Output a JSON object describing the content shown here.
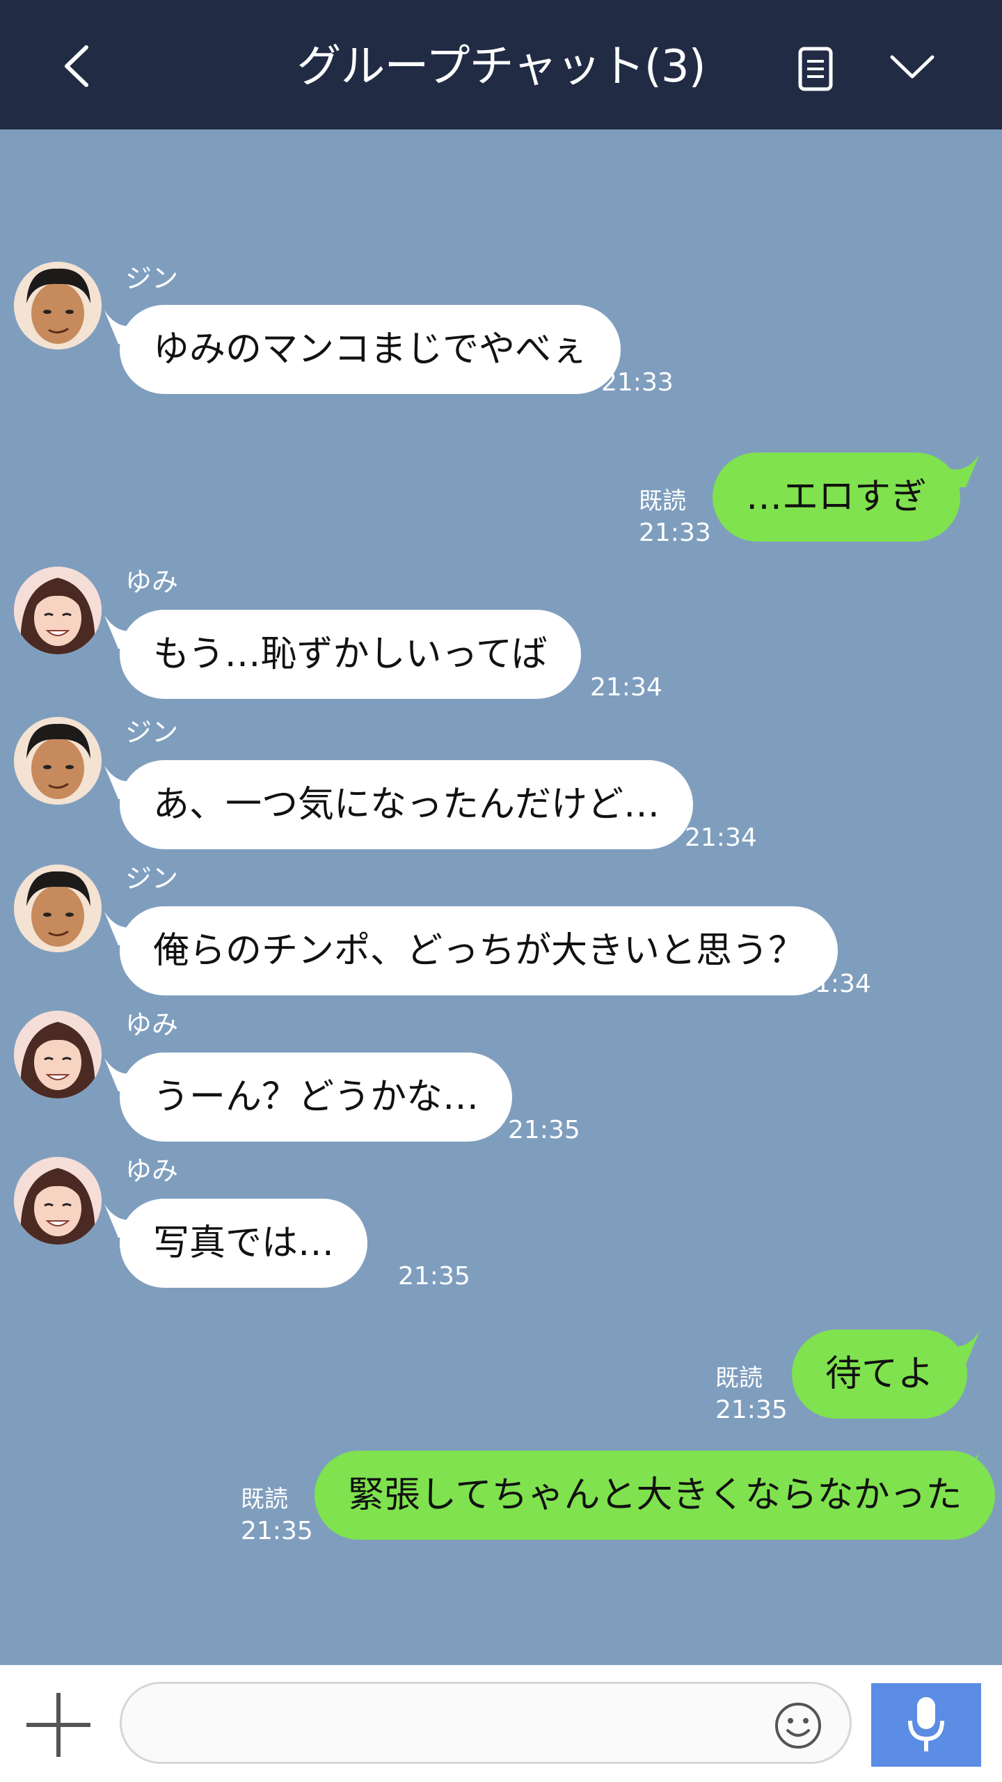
{
  "header": {
    "title": "グループチャット(3)",
    "back_icon": "chevron-left-icon",
    "notes_icon": "notes-icon",
    "menu_icon": "chevron-down-icon",
    "bg_color": "#212b44"
  },
  "chat": {
    "bg_color": "#7f9ebe",
    "incoming_color": "#ffffff",
    "outgoing_color": "#7fe24e",
    "messages": [
      {
        "dir": "in",
        "sender": "ジン",
        "text": "ゆみのマンコまじでやべぇ",
        "time": "21:33"
      },
      {
        "dir": "out",
        "read": "既読",
        "text": "…エロすぎ",
        "time": "21:33"
      },
      {
        "dir": "in",
        "sender": "ゆみ",
        "text": "もう…恥ずかしいってば",
        "time": "21:34"
      },
      {
        "dir": "in",
        "sender": "ジン",
        "text": "あ、一つ気になったんだけど…",
        "time": "21:34"
      },
      {
        "dir": "in",
        "sender": "ジン",
        "text": "俺らのチンポ、どっちが大きいと思う？",
        "time": "21:34"
      },
      {
        "dir": "in",
        "sender": "ゆみ",
        "text": "うーん？どうかな…",
        "time": "21:35"
      },
      {
        "dir": "in",
        "sender": "ゆみ",
        "text": "写真では…",
        "time": "21:35"
      },
      {
        "dir": "out",
        "read": "既読",
        "text": "待てよ",
        "time": "21:35"
      },
      {
        "dir": "out",
        "read": "既読",
        "text": "緊張してちゃんと大きくならなかった",
        "time": "21:35"
      }
    ]
  },
  "input_bar": {
    "plus_icon": "plus-icon",
    "input_value": "",
    "input_placeholder": "",
    "emoji_icon": "smiley-icon",
    "mic_icon": "microphone-icon",
    "mic_color": "#5a8de3"
  }
}
